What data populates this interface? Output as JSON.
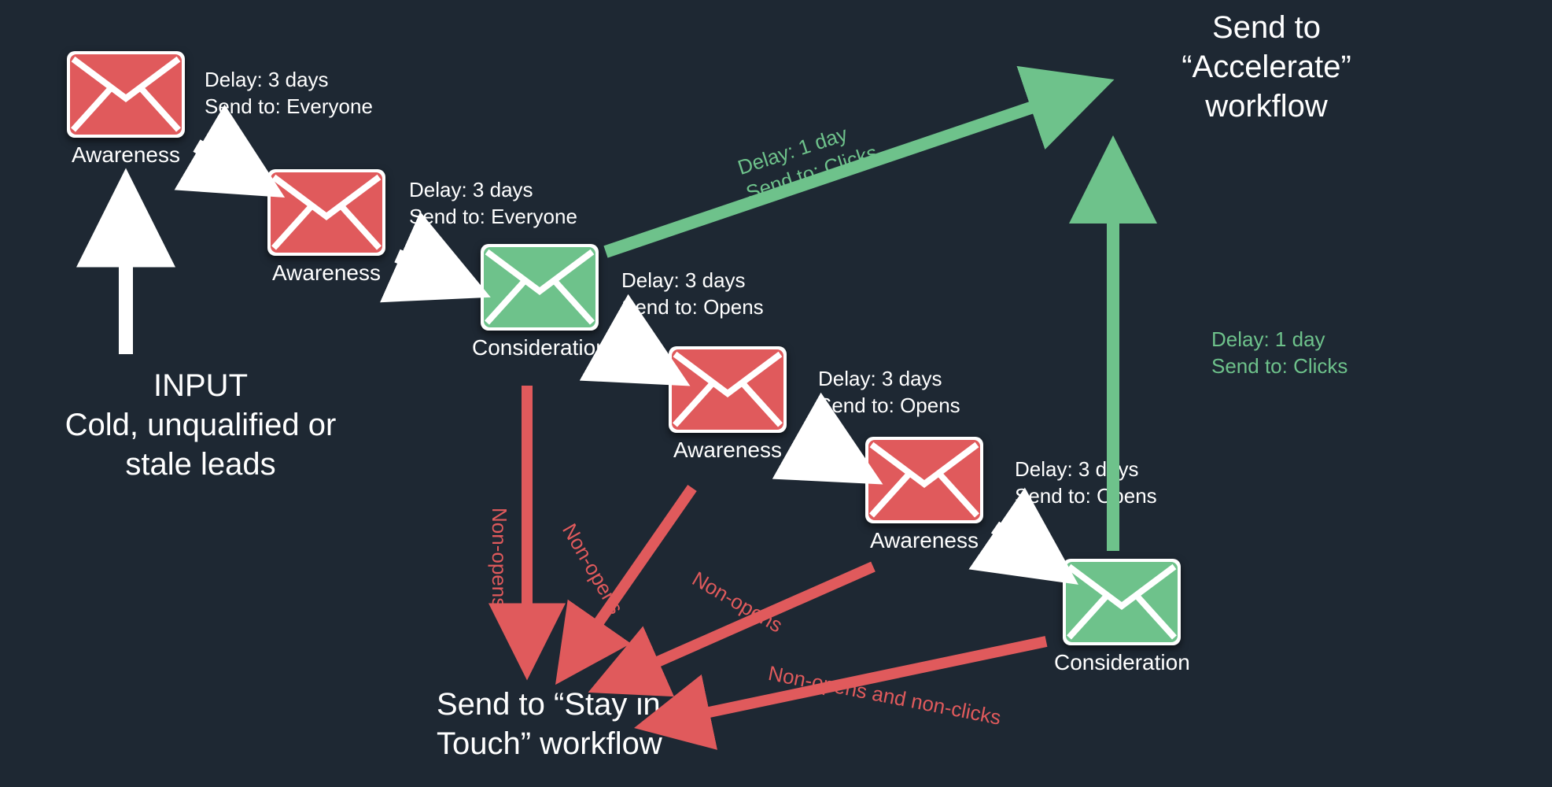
{
  "colors": {
    "bg": "#1e2833",
    "red": "#e05a5c",
    "green": "#6ec28b",
    "white": "#ffffff"
  },
  "input": {
    "title": "INPUT",
    "subtitle": "Cold, unqualified or\nstale leads"
  },
  "accelerate": "Send to\n“Accelerate”\nworkflow",
  "stayInTouch": "Send to “Stay in\nTouch” workflow",
  "nodes": [
    {
      "id": "n1",
      "label": "Awareness",
      "type": "awareness"
    },
    {
      "id": "n2",
      "label": "Awareness",
      "type": "awareness"
    },
    {
      "id": "n3",
      "label": "Consideration",
      "type": "consideration"
    },
    {
      "id": "n4",
      "label": "Awareness",
      "type": "awareness"
    },
    {
      "id": "n5",
      "label": "Awareness",
      "type": "awareness"
    },
    {
      "id": "n6",
      "label": "Consideration",
      "type": "consideration"
    }
  ],
  "rules": [
    {
      "id": "r1",
      "delay": "Delay: 3 days",
      "to": "Send to: Everyone"
    },
    {
      "id": "r2",
      "delay": "Delay: 3 days",
      "to": "Send to: Everyone"
    },
    {
      "id": "r3",
      "delay": "Delay: 3 days",
      "to": "Send to: Opens"
    },
    {
      "id": "r4",
      "delay": "Delay: 3 days",
      "to": "Send to: Opens"
    },
    {
      "id": "r5",
      "delay": "Delay: 3 days",
      "to": "Send to: Opens"
    },
    {
      "id": "rc1",
      "delay": "Delay: 1 day",
      "to": "Send to: Clicks"
    },
    {
      "id": "rc2",
      "delay": "Delay: 1 day",
      "to": "Send to: Clicks"
    }
  ],
  "pathLabels": {
    "nonOpens": "Non-opens",
    "nonOpensClicks": "Non-opens and non-clicks"
  }
}
